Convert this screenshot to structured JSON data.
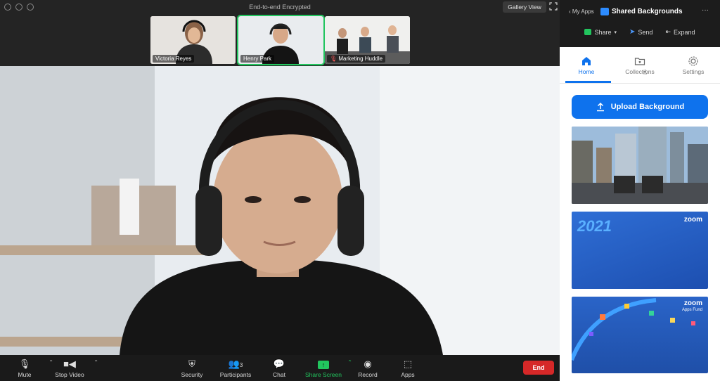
{
  "window": {
    "title": "End-to-end Encrypted",
    "gallery_button": "Gallery View"
  },
  "participants": [
    {
      "name": "Victoria Reyes"
    },
    {
      "name": "Henry Park"
    },
    {
      "name": "Marketing Huddle"
    }
  ],
  "controls": {
    "mute": "Mute",
    "stop_video": "Stop Video",
    "security": "Security",
    "participants": "Participants",
    "participants_count": "3",
    "chat": "Chat",
    "share_screen": "Share Screen",
    "record": "Record",
    "apps": "Apps",
    "end": "End"
  },
  "panel": {
    "back_label": "My Apps",
    "app_name": "Shared Backgrounds",
    "actions": {
      "share": "Share",
      "send": "Send",
      "expand": "Expand"
    },
    "tabs": [
      "Home",
      "Collections",
      "Settings"
    ],
    "active_tab": "Home",
    "upload_button": "Upload Background",
    "cards": [
      {
        "text": ""
      },
      {
        "text": "2021",
        "brand": "zoom"
      },
      {
        "text": "Apps Fund",
        "brand": "zoom"
      }
    ]
  },
  "colors": {
    "accent": "#0e72ed",
    "end_red": "#d62828",
    "active_green": "#22c55e"
  }
}
